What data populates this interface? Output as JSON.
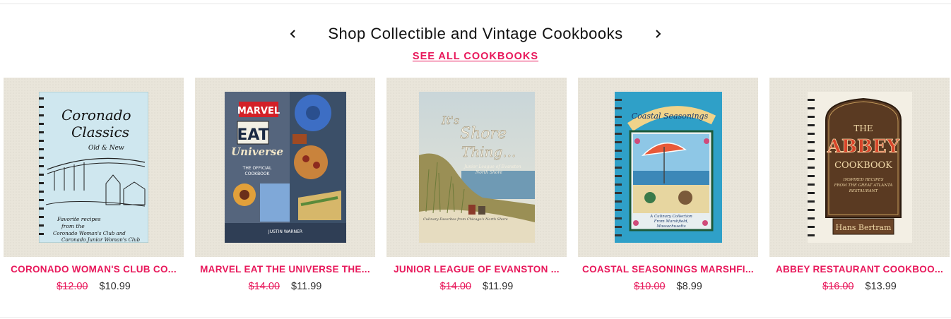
{
  "section": {
    "title": "Shop Collectible and Vintage Cookbooks",
    "see_all_label": "SEE ALL COOKBOOKS"
  },
  "products": [
    {
      "name": "CORONADO WOMAN'S CLUB CO...",
      "old_price": "$12.00",
      "price": "$10.99",
      "cover": {
        "title_line1": "Coronado",
        "title_line2": "Classics",
        "title_line3": "Old & New",
        "subtitle": "Favorite recipes from the Coronado Woman's Club and Coronado Junior Woman's Club",
        "color": "#cfe7ef"
      }
    },
    {
      "name": "MARVEL EAT THE UNIVERSE THE...",
      "old_price": "$14.00",
      "price": "$11.99",
      "cover": {
        "logo": "MARVEL",
        "title_line1": "EAT",
        "title_line2": "Universe",
        "subtitle": "THE OFFICIAL COOKBOOK",
        "author": "JUSTIN WARNER",
        "color": "#3b4f68"
      }
    },
    {
      "name": "JUNIOR LEAGUE OF EVANSTON ...",
      "old_price": "$14.00",
      "price": "$11.99",
      "cover": {
        "title_line1": "It's",
        "title_line2": "Shore",
        "title_line3": "Thing...",
        "subtitle": "Junior League of Evanston North Shore",
        "color": "#b8cbd6"
      }
    },
    {
      "name": "COASTAL SEASONINGS MARSHFI...",
      "old_price": "$10.00",
      "price": "$8.99",
      "cover": {
        "title_line1": "Coastal Seasonings",
        "subtitle": "A Culinary Collection From Marshfield, Massachusetts",
        "color": "#2fa0c8"
      }
    },
    {
      "name": "ABBEY RESTAURANT COOKBOO...",
      "old_price": "$16.00",
      "price": "$13.99",
      "cover": {
        "title_line1": "THE",
        "title_line2": "ABBEY",
        "title_line3": "COOKBOOK",
        "subtitle": "INSPIRED RECIPES FROM THE GREAT ATLANTA RESTAURANT",
        "author": "Hans Bertram",
        "color": "#5a3a22"
      }
    }
  ],
  "icons": {
    "prev": "chevron-left-icon",
    "next": "chevron-right-icon"
  }
}
